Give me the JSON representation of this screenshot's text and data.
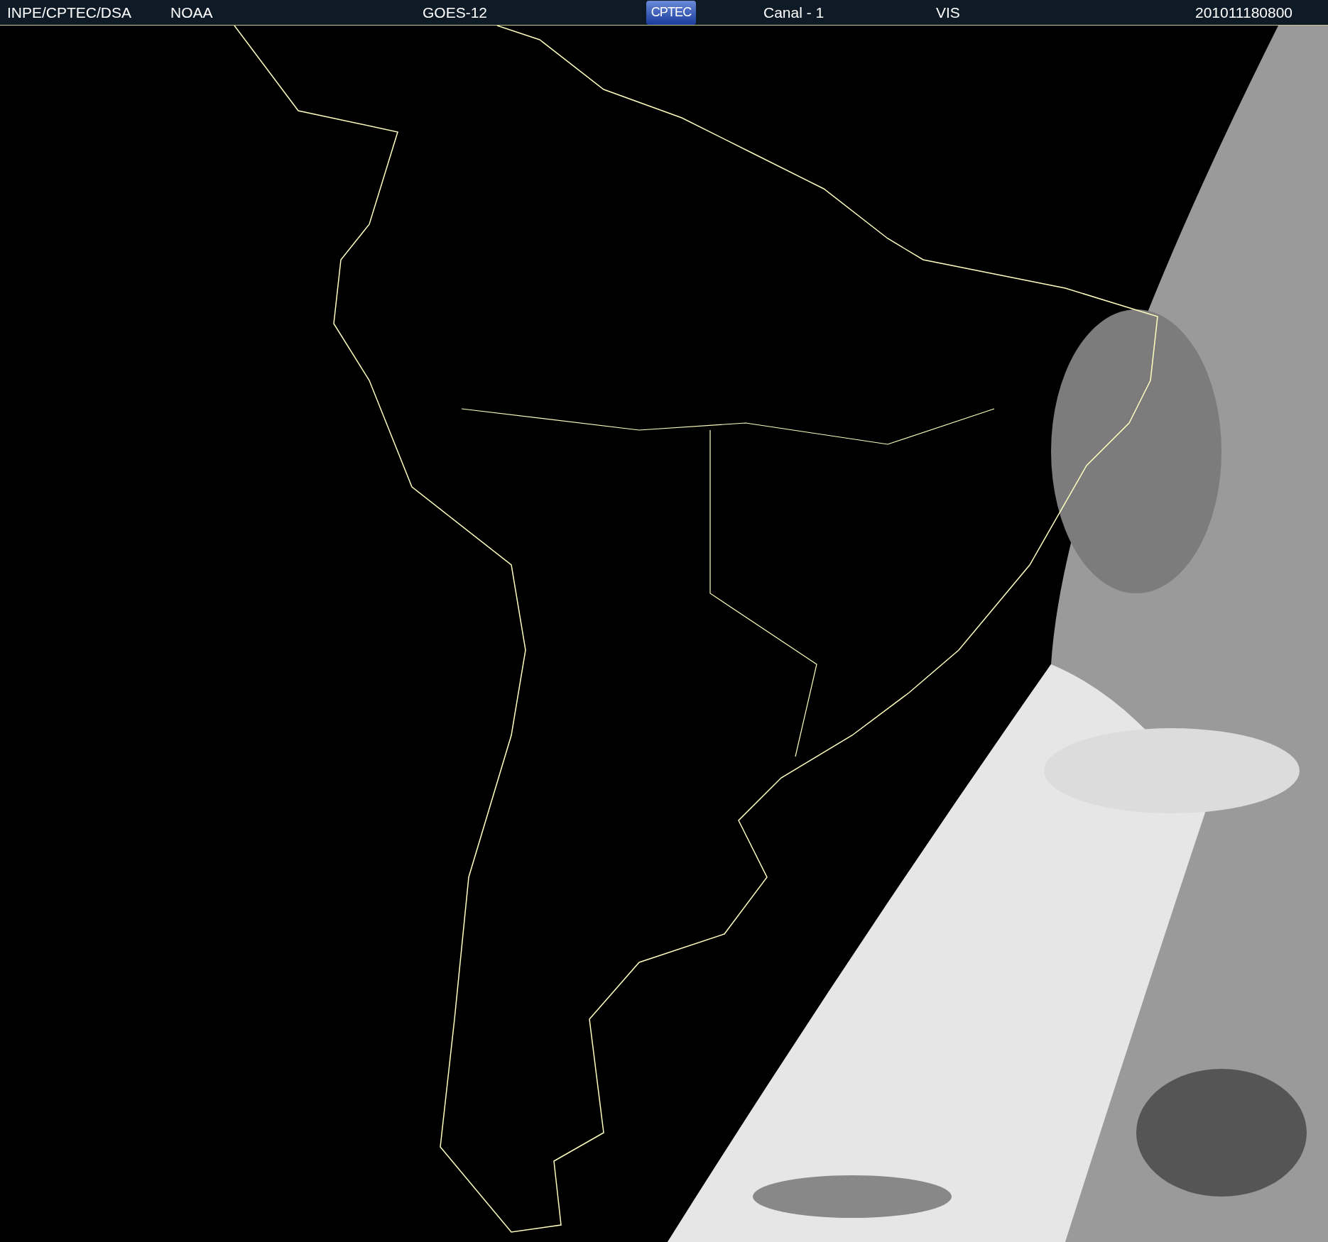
{
  "header": {
    "source": "INPE/CPTEC/DSA",
    "agency": "NOAA",
    "satellite": "GOES-12",
    "logo": "CPTEC",
    "channel": "Canal - 1",
    "band": "VIS",
    "timestamp": "201011180800"
  }
}
